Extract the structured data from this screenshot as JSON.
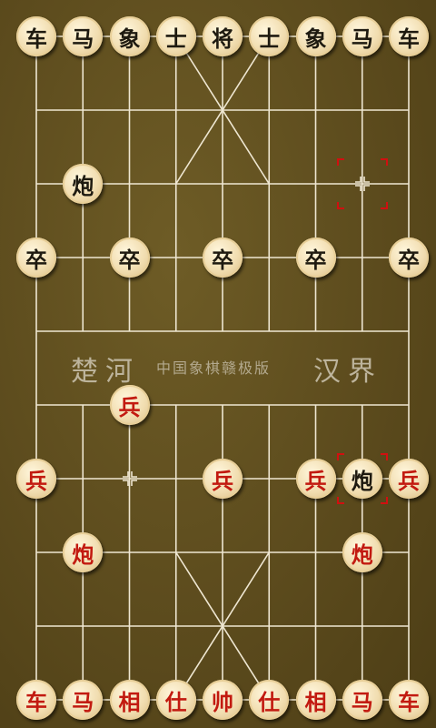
{
  "river": {
    "left": "楚河",
    "center": "中国象棋赣极版",
    "right": "汉界"
  },
  "colors": {
    "board": "#5c4b1d",
    "line": "#efe7d2",
    "black_piece": "#1e1a10",
    "red_piece": "#c21a10",
    "marker": "#d01010"
  },
  "pieces": [
    {
      "col": 0,
      "row": 0,
      "label": "车",
      "side": "black"
    },
    {
      "col": 1,
      "row": 0,
      "label": "马",
      "side": "black"
    },
    {
      "col": 2,
      "row": 0,
      "label": "象",
      "side": "black"
    },
    {
      "col": 3,
      "row": 0,
      "label": "士",
      "side": "black"
    },
    {
      "col": 4,
      "row": 0,
      "label": "将",
      "side": "black"
    },
    {
      "col": 5,
      "row": 0,
      "label": "士",
      "side": "black"
    },
    {
      "col": 6,
      "row": 0,
      "label": "象",
      "side": "black"
    },
    {
      "col": 7,
      "row": 0,
      "label": "马",
      "side": "black"
    },
    {
      "col": 8,
      "row": 0,
      "label": "车",
      "side": "black"
    },
    {
      "col": 1,
      "row": 2,
      "label": "炮",
      "side": "black"
    },
    {
      "col": 0,
      "row": 3,
      "label": "卒",
      "side": "black"
    },
    {
      "col": 2,
      "row": 3,
      "label": "卒",
      "side": "black"
    },
    {
      "col": 4,
      "row": 3,
      "label": "卒",
      "side": "black"
    },
    {
      "col": 6,
      "row": 3,
      "label": "卒",
      "side": "black"
    },
    {
      "col": 8,
      "row": 3,
      "label": "卒",
      "side": "black"
    },
    {
      "col": 2,
      "row": 5,
      "label": "兵",
      "side": "red"
    },
    {
      "col": 0,
      "row": 6,
      "label": "兵",
      "side": "red"
    },
    {
      "col": 4,
      "row": 6,
      "label": "兵",
      "side": "red"
    },
    {
      "col": 6,
      "row": 6,
      "label": "兵",
      "side": "red"
    },
    {
      "col": 7,
      "row": 6,
      "label": "炮",
      "side": "black"
    },
    {
      "col": 8,
      "row": 6,
      "label": "兵",
      "side": "red"
    },
    {
      "col": 1,
      "row": 7,
      "label": "炮",
      "side": "red"
    },
    {
      "col": 7,
      "row": 7,
      "label": "炮",
      "side": "red"
    },
    {
      "col": 0,
      "row": 9,
      "label": "车",
      "side": "red"
    },
    {
      "col": 1,
      "row": 9,
      "label": "马",
      "side": "red"
    },
    {
      "col": 2,
      "row": 9,
      "label": "相",
      "side": "red"
    },
    {
      "col": 3,
      "row": 9,
      "label": "仕",
      "side": "red"
    },
    {
      "col": 4,
      "row": 9,
      "label": "帅",
      "side": "red"
    },
    {
      "col": 5,
      "row": 9,
      "label": "仕",
      "side": "red"
    },
    {
      "col": 6,
      "row": 9,
      "label": "相",
      "side": "red"
    },
    {
      "col": 7,
      "row": 9,
      "label": "马",
      "side": "red"
    },
    {
      "col": 8,
      "row": 9,
      "label": "车",
      "side": "red"
    }
  ],
  "move_markers": [
    {
      "col": 7,
      "row": 2,
      "kind": "from"
    },
    {
      "col": 7,
      "row": 6,
      "kind": "to"
    }
  ],
  "crosshairs": [
    {
      "col": 7,
      "row": 2
    },
    {
      "col": 2,
      "row": 6
    }
  ]
}
